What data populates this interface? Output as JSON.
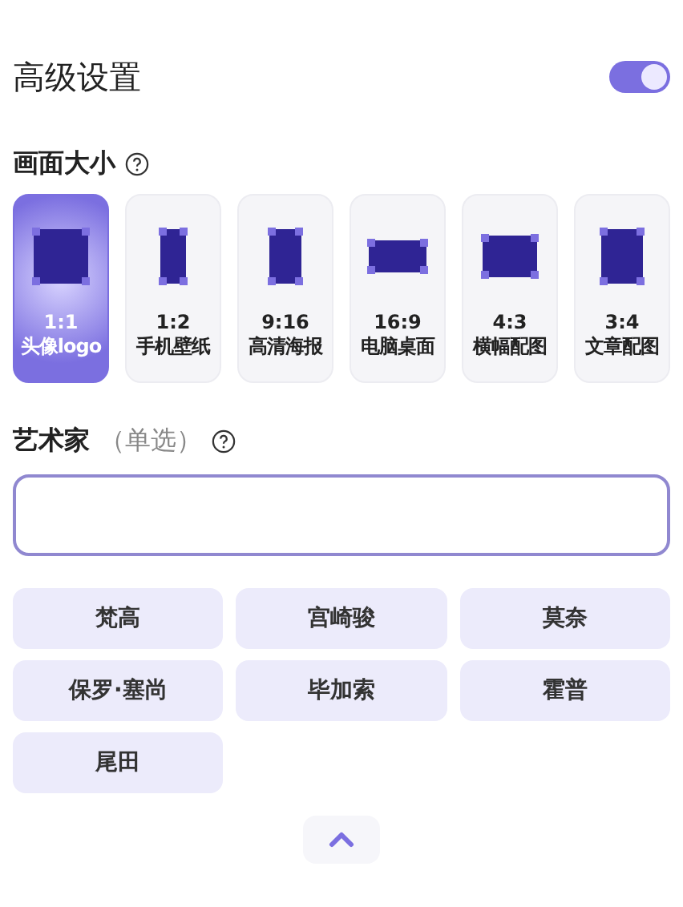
{
  "header": {
    "title": "高级设置",
    "toggle": {
      "on": true
    }
  },
  "size": {
    "label": "画面大小",
    "options": [
      {
        "ratio": "1:1",
        "label": "头像logo",
        "kind": "square",
        "selected": true
      },
      {
        "ratio": "1:2",
        "label": "手机壁纸",
        "kind": "tall",
        "selected": false
      },
      {
        "ratio": "9:16",
        "label": "高清海报",
        "kind": "portrait",
        "selected": false
      },
      {
        "ratio": "16:9",
        "label": "电脑桌面",
        "kind": "wide",
        "selected": false
      },
      {
        "ratio": "4:3",
        "label": "横幅配图",
        "kind": "landscape",
        "selected": false
      },
      {
        "ratio": "3:4",
        "label": "文章配图",
        "kind": "upright",
        "selected": false
      }
    ]
  },
  "artist": {
    "label": "艺术家",
    "hint": "（单选）",
    "chips": [
      {
        "label": "梵高",
        "selected": false
      },
      {
        "label": "宫崎骏",
        "selected": false
      },
      {
        "label": "莫奈",
        "selected": false
      },
      {
        "label": "保罗·塞尚",
        "selected": false
      },
      {
        "label": "毕加索",
        "selected": false
      },
      {
        "label": "霍普",
        "selected": false
      },
      {
        "label": "尾田",
        "selected": false
      }
    ]
  }
}
